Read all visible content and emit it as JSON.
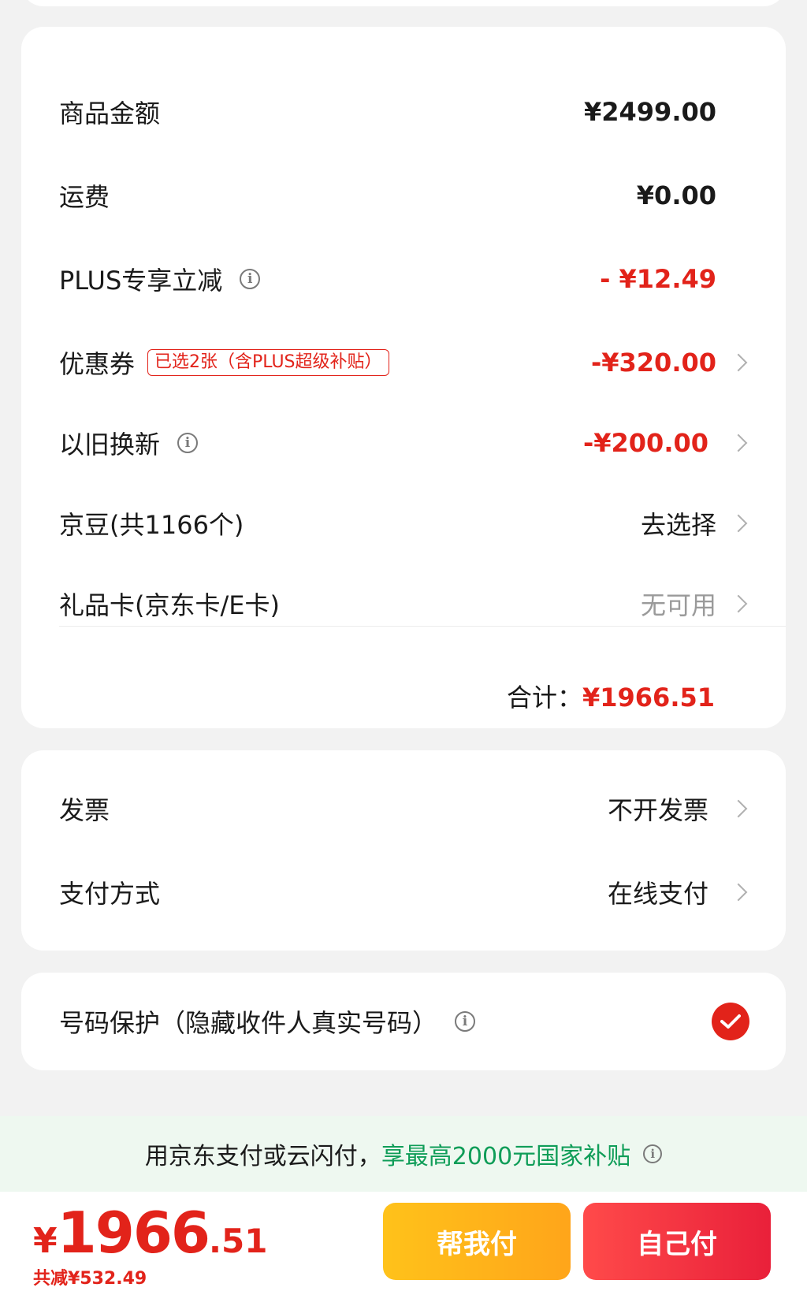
{
  "summary": {
    "goods_amount": {
      "label": "商品金额",
      "value": "¥2499.00"
    },
    "shipping": {
      "label": "运费",
      "value": "¥0.00"
    },
    "plus_discount": {
      "label": "PLUS专享立减",
      "value": "- ¥12.49"
    },
    "coupon": {
      "label": "优惠券",
      "tag": "已选2张（含PLUS超级补贴）",
      "value": "-¥320.00"
    },
    "trade_in": {
      "label": "以旧换新",
      "value": "-¥200.00"
    },
    "jd_beans": {
      "label": "京豆(共1166个)",
      "value": "去选择"
    },
    "gift_card": {
      "label": "礼品卡(京东卡/E卡)",
      "value": "无可用"
    },
    "total": {
      "label": "合计：",
      "value": "¥1966.51"
    }
  },
  "payment": {
    "invoice": {
      "label": "发票",
      "value": "不开发票"
    },
    "method": {
      "label": "支付方式",
      "value": "在线支付"
    }
  },
  "privacy": {
    "label": "号码保护（隐藏收件人真实号码）",
    "checked": true
  },
  "banner": {
    "text_plain": "用京东支付或云闪付，",
    "text_highlight": "享最高2000元国家补贴"
  },
  "bottom": {
    "currency": "¥",
    "price_int": "1966",
    "price_dec": ".51",
    "saved": "共减¥532.49",
    "help_pay_label": "帮我付",
    "self_pay_label": "自己付"
  },
  "colors": {
    "accent_red": "#e2231a",
    "subsidy_green": "#0f9d58",
    "help_btn": "#ffb31a",
    "self_btn": "#f0303f"
  }
}
